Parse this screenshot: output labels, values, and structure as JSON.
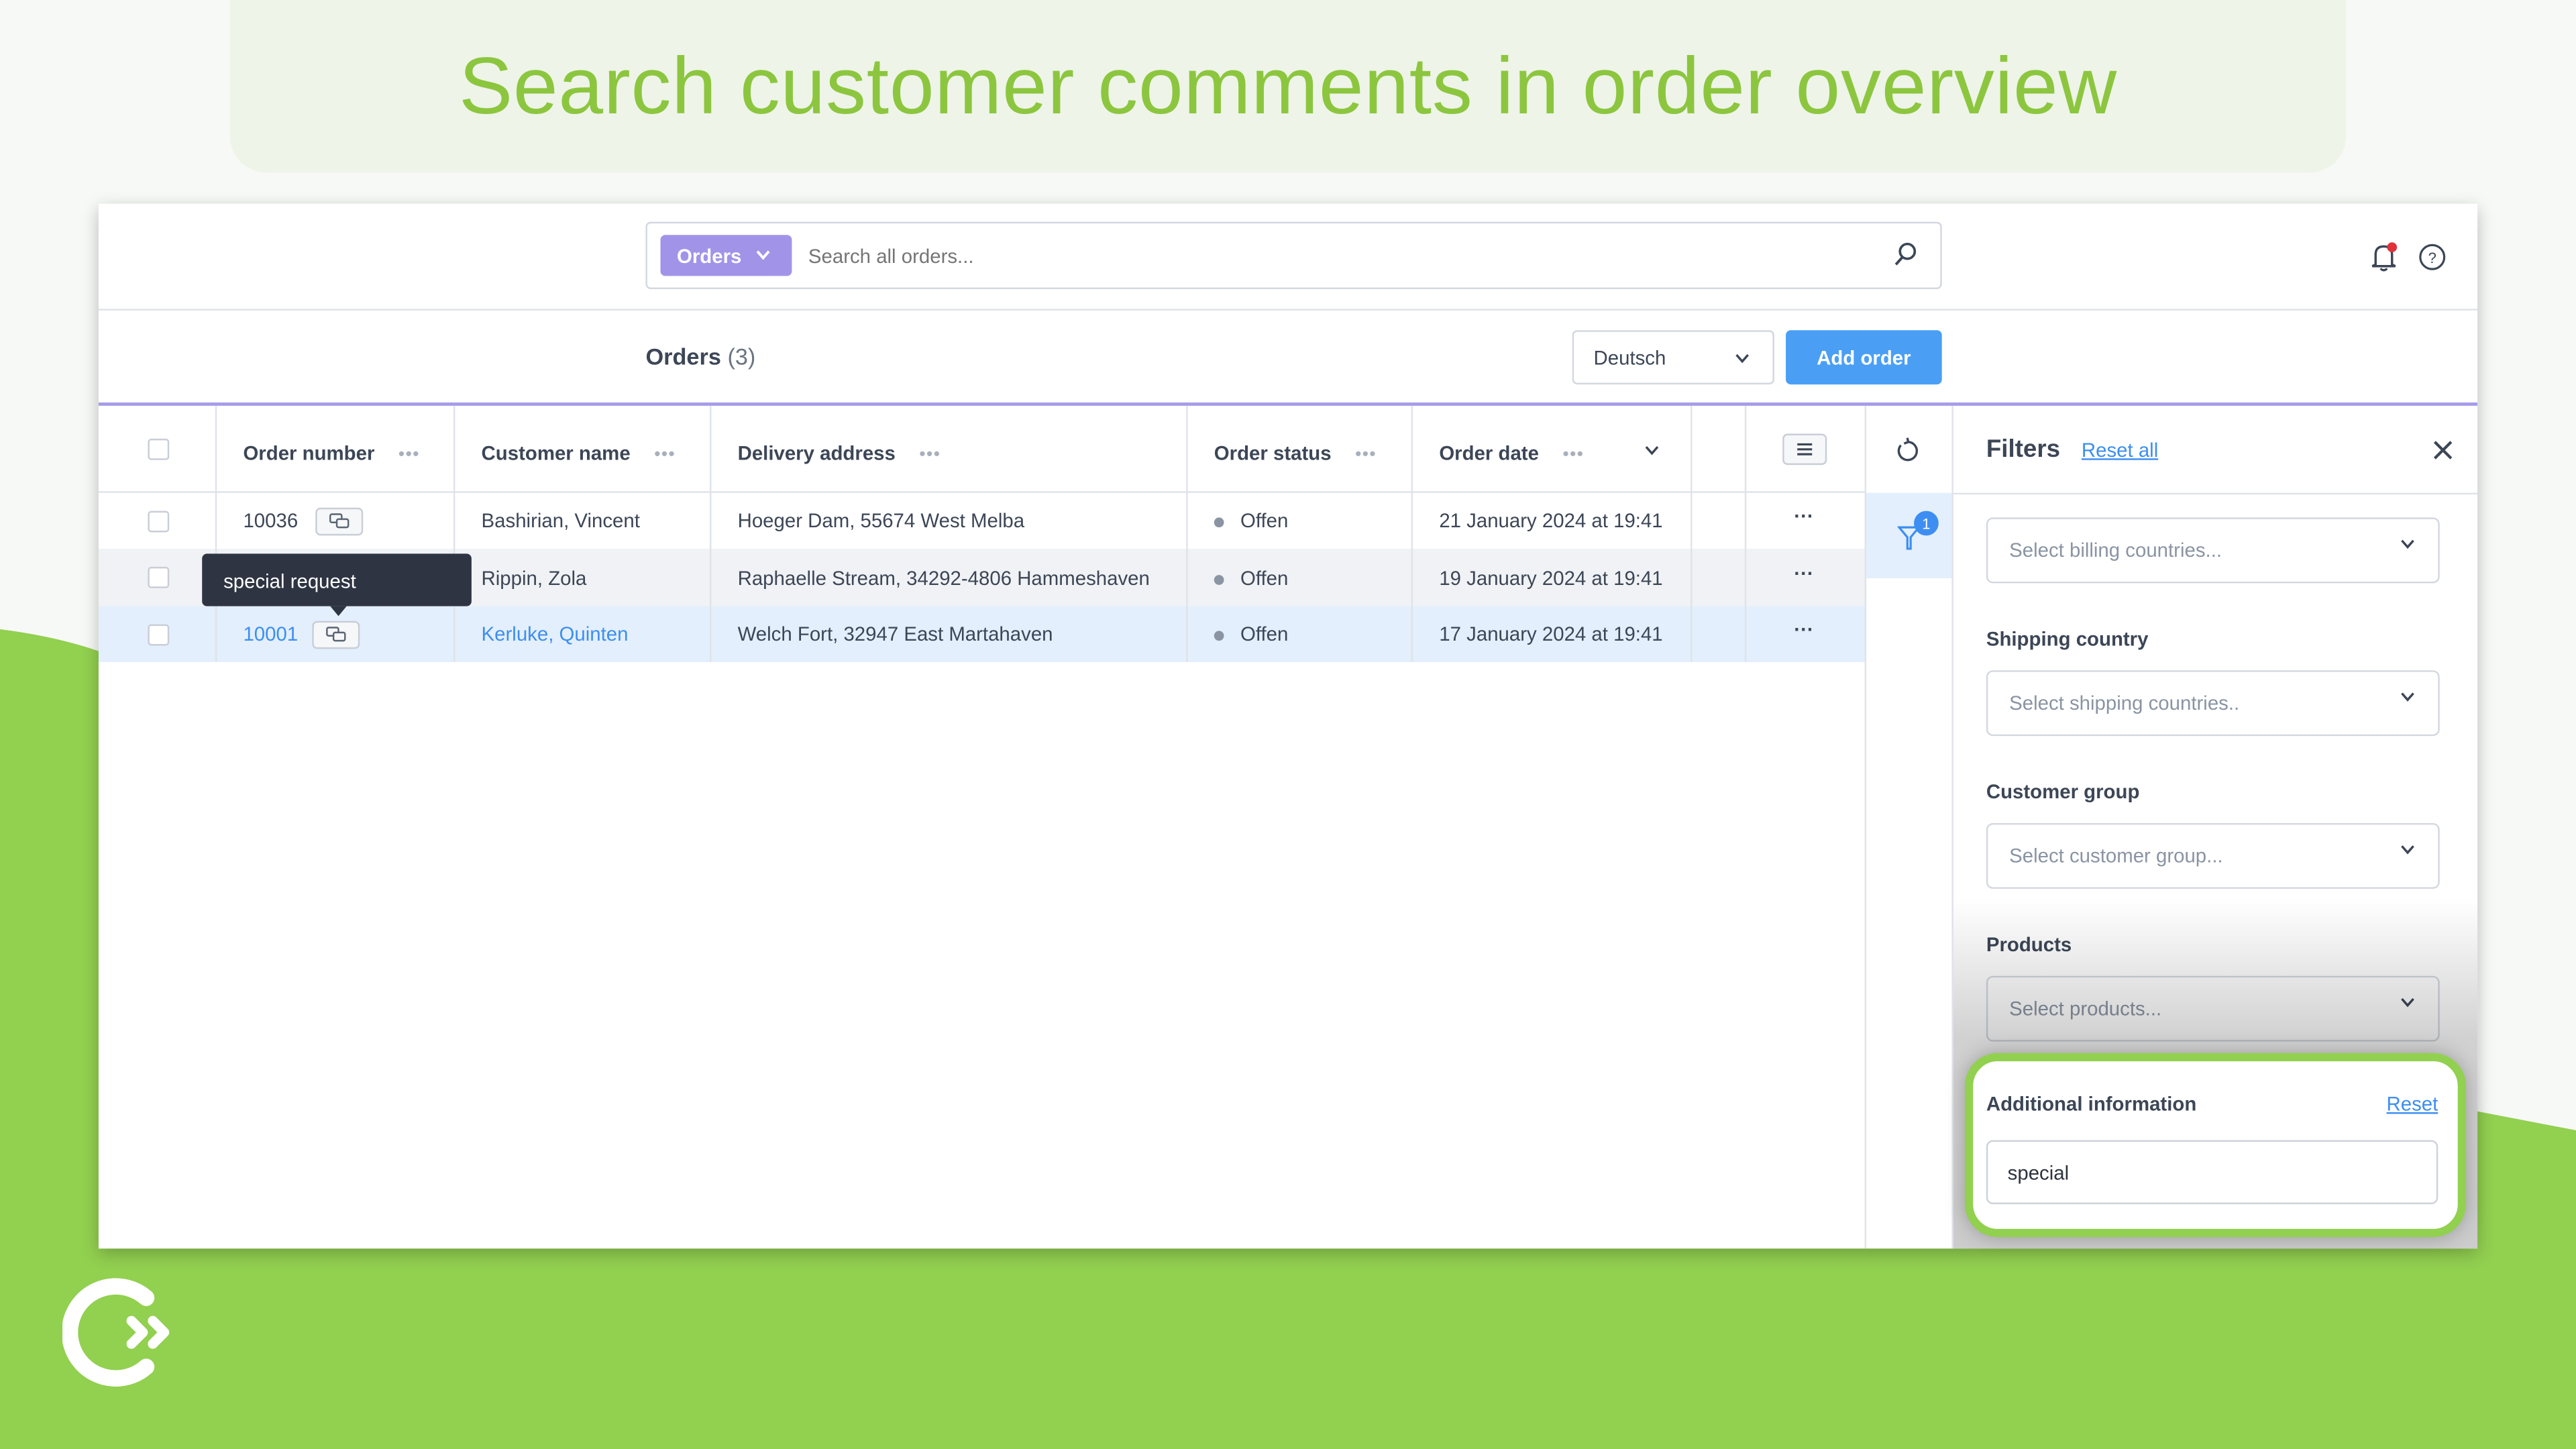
{
  "banner": {
    "title": "Search customer comments in order overview"
  },
  "colors": {
    "brand_green": "#92d050",
    "accent_purple": "#a194e8",
    "primary_blue": "#4a9ff5",
    "link_blue": "#3d8ef0",
    "tooltip_bg": "#2e3442",
    "selected_row": "#e3effd"
  },
  "topbar": {
    "search_type": "Orders",
    "search_placeholder": "Search all orders...",
    "icons": [
      "search-icon",
      "bell-icon",
      "help-icon"
    ]
  },
  "toolbar": {
    "title": "Orders",
    "count": "(3)",
    "language": "Deutsch",
    "add_order": "Add order"
  },
  "table": {
    "columns": [
      "Order number",
      "Customer name",
      "Delivery address",
      "Order status",
      "Order date"
    ],
    "rows": [
      {
        "order_number": "10036",
        "customer": "Bashirian, Vincent",
        "address": "Hoeger Dam, 55674 West Melba",
        "status": "Offen",
        "date": "21 January 2024 at 19:41",
        "has_comment": true
      },
      {
        "order_number": "",
        "customer": "Rippin, Zola",
        "address": "Raphaelle Stream, 34292-4806 Hammeshaven",
        "status": "Offen",
        "date": "19 January 2024 at 19:41",
        "has_comment": false
      },
      {
        "order_number": "10001",
        "customer": "Kerluke, Quinten",
        "address": "Welch Fort, 32947 East Martahaven",
        "status": "Offen",
        "date": "17 January 2024 at 19:41",
        "has_comment": true,
        "selected": true
      }
    ],
    "tooltip": "special request"
  },
  "filters": {
    "title": "Filters",
    "reset_all": "Reset all",
    "active_count": "1",
    "billing_placeholder": "Select billing countries...",
    "shipping_label": "Shipping country",
    "shipping_placeholder": "Select shipping countries..",
    "group_label": "Customer group",
    "group_placeholder": "Select customer group...",
    "products_label": "Products",
    "products_placeholder": "Select products...",
    "additional_label": "Additional information",
    "additional_reset": "Reset",
    "additional_value": "special"
  }
}
